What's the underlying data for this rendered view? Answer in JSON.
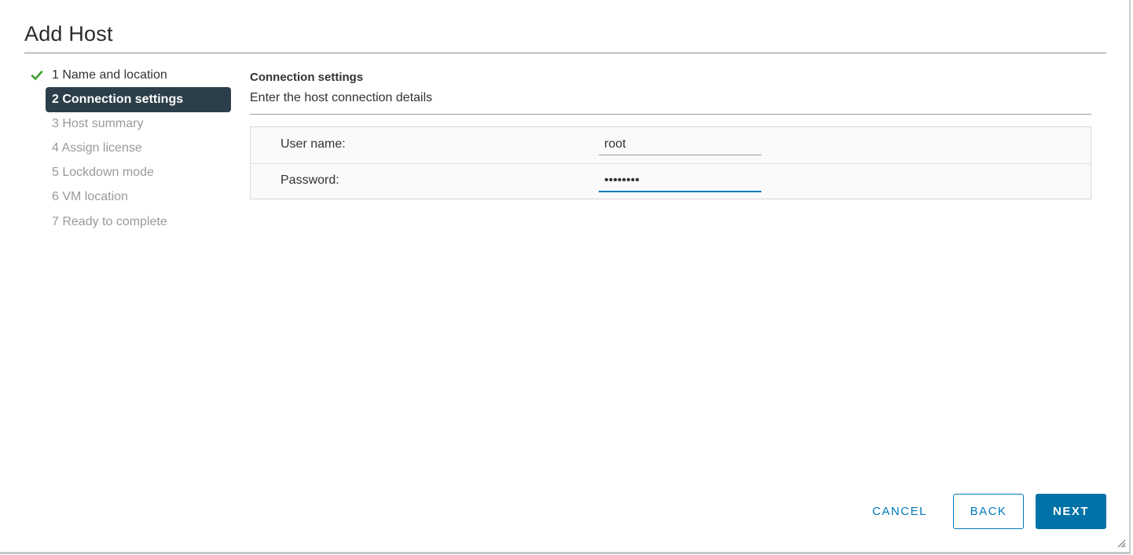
{
  "dialog": {
    "title": "Add Host"
  },
  "steps": [
    {
      "label": "1 Name and location",
      "state": "completed"
    },
    {
      "label": "2 Connection settings",
      "state": "active"
    },
    {
      "label": "3 Host summary",
      "state": "pending"
    },
    {
      "label": "4 Assign license",
      "state": "pending"
    },
    {
      "label": "5 Lockdown mode",
      "state": "pending"
    },
    {
      "label": "6 VM location",
      "state": "pending"
    },
    {
      "label": "7 Ready to complete",
      "state": "pending"
    }
  ],
  "content": {
    "title": "Connection settings",
    "description": "Enter the host connection details",
    "fields": {
      "username": {
        "label": "User name:",
        "value": "root"
      },
      "password": {
        "label": "Password:",
        "value": "••••••••"
      }
    }
  },
  "footer": {
    "cancel_label": "CANCEL",
    "back_label": "BACK",
    "next_label": "NEXT"
  },
  "colors": {
    "accent": "#0079b8",
    "primary_button": "#0072a8",
    "active_step_bg": "#2c3e4a",
    "check": "#3c9f2d"
  },
  "icons": {
    "step_completed": "check-icon",
    "resize": "resize-handle-icon"
  }
}
